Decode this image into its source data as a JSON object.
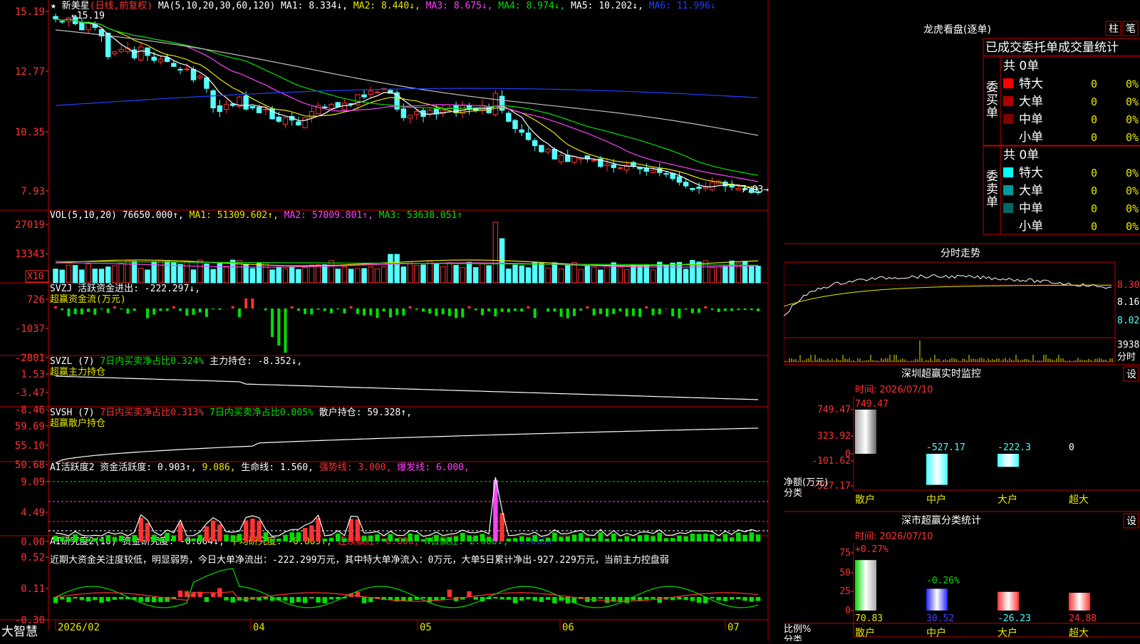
{
  "stock": {
    "name": "新美星",
    "period": "(日线,前复权)",
    "logo": "大智慧",
    "top_price_label": "15.19",
    "low_label": "7.93"
  },
  "colors": {
    "up": "#ff3232",
    "down": "#54ffff",
    "green": "#00e000",
    "ma1": "#ffffff",
    "ma2": "#e8e800",
    "ma3": "#ff40ff",
    "ma4": "#00e000",
    "ma5": "#c0c0c0",
    "ma6": "#2040ff",
    "border": "#c00000",
    "axis_label": "#ff3232"
  },
  "panes": {
    "kline": {
      "header": [
        {
          "t": "MA(5,10,20,30,60,120)",
          "c": "#ffffff"
        },
        {
          "t": "MA1: 8.334↓,",
          "c": "#ffffff"
        },
        {
          "t": "MA2: 8.440↓,",
          "c": "#e8e800"
        },
        {
          "t": "MA3: 8.675↓,",
          "c": "#ff40ff"
        },
        {
          "t": "MA4: 8.974↓,",
          "c": "#00e000"
        },
        {
          "t": "MA5: 10.202↓,",
          "c": "#ffffff"
        },
        {
          "t": "MA6: 11.996↓",
          "c": "#2040ff"
        }
      ],
      "yticks": [
        "15.19",
        "12.77",
        "10.35",
        "7.93"
      ]
    },
    "vol": {
      "header": [
        {
          "t": "VOL(5,10,20)",
          "c": "#ffffff"
        },
        {
          "t": "76650.000↑,",
          "c": "#ffffff"
        },
        {
          "t": "MA1: 51309.602↑,",
          "c": "#e8e800"
        },
        {
          "t": "MA2: 57009.801↑,",
          "c": "#ff40ff"
        },
        {
          "t": "MA3: 53638.051↑",
          "c": "#00e000"
        }
      ],
      "yticks": [
        "27019",
        "13343"
      ],
      "unit": "X10"
    },
    "svzj": {
      "header": [
        {
          "t": "SVZJ",
          "c": "#ffffff"
        },
        {
          "t": "活跃资金进出: -222.297↓,",
          "c": "#ffffff"
        }
      ],
      "sub": "超赢资金流(万元)",
      "yticks": [
        "726",
        "-1037",
        "-2801"
      ]
    },
    "svzl": {
      "header": [
        {
          "t": "SVZL (7)",
          "c": "#ffffff"
        },
        {
          "t": "7日内买卖净占比0.324%",
          "c": "#00e000"
        },
        {
          "t": "主力持仓: -8.352↓,",
          "c": "#ffffff"
        }
      ],
      "sub": "超赢主力持仓",
      "yticks": [
        "1.53",
        "-3.47",
        "-8.46"
      ]
    },
    "svsh": {
      "header": [
        {
          "t": "SVSH (7)",
          "c": "#ffffff"
        },
        {
          "t": "7日内买卖净占比0.313%",
          "c": "#ff3232"
        },
        {
          "t": "7日内买卖净占比0.005%",
          "c": "#00e000"
        },
        {
          "t": "散户持仓: 59.328↑,",
          "c": "#ffffff"
        }
      ],
      "sub": "超赢散户持仓",
      "yticks": [
        "59.69",
        "55.10",
        "50.68"
      ]
    },
    "ai1": {
      "header": [
        {
          "t": "AI活跃度2",
          "c": "#ffffff"
        },
        {
          "t": "资金活跃度: 0.903↑,",
          "c": "#ffffff"
        },
        {
          "t": "9.086,",
          "c": "#e8e800"
        },
        {
          "t": "生命线: 1.560,",
          "c": "#ffffff"
        },
        {
          "t": "强势线: 3.000,",
          "c": "#ff3232"
        },
        {
          "t": "爆发线: 6.000,",
          "c": "#ff40ff"
        }
      ],
      "yticks": [
        "9.09",
        "4.49",
        "0.00"
      ]
    },
    "ai2": {
      "header": [
        {
          "t": "AI研究度2(10)",
          "c": "#ffffff"
        },
        {
          "t": "资金研究度: -0.004↓,",
          "c": "#ffffff"
        },
        {
          "t": "平均研究度: -0.069↑,",
          "c": "#e8e800"
        },
        {
          "t": "连续飘红: 0.000,",
          "c": "#ff3232"
        },
        {
          "t": "N日飘红: 2.000↓,",
          "c": "#00e000"
        },
        {
          "t": "-0.069↑",
          "c": "#2040ff"
        }
      ],
      "comment": "近期大资金关注度较低，明显弱势，今日大单净流出：-222.299万元，其中特大单净流入：0万元，大单5日累计净出-927.229万元，当前主力控盘弱",
      "yticks": [
        "0.52",
        "0.11",
        "-0.30"
      ]
    }
  },
  "dates": [
    "2026/02",
    "04",
    "05",
    "06",
    "07"
  ],
  "chart_data": {
    "type": "candlestick",
    "ylim": [
      7.5,
      15.3
    ],
    "close": [
      15.05,
      14.95,
      15.1,
      14.85,
      14.6,
      14.9,
      14.7,
      14.35,
      13.5,
      13.7,
      13.8,
      13.85,
      13.45,
      13.9,
      13.55,
      13.35,
      13.4,
      13.3,
      13.1,
      12.95,
      13.0,
      12.55,
      12.7,
      12.2,
      11.4,
      11.25,
      11.55,
      11.5,
      11.85,
      11.35,
      11.4,
      11.2,
      11.35,
      10.95,
      10.85,
      11.0,
      10.9,
      10.7,
      11.0,
      11.25,
      11.5,
      11.4,
      11.55,
      11.45,
      11.6,
      11.55,
      11.95,
      11.85,
      12.1,
      12.05,
      12.2,
      12.0,
      11.35,
      11.0,
      11.1,
      11.25,
      11.05,
      11.3,
      11.15,
      11.3,
      11.4,
      11.2,
      11.5,
      11.35,
      11.3,
      11.5,
      11.2,
      12.0,
      11.3,
      10.85,
      10.55,
      10.4,
      10.1,
      9.85,
      9.6,
      9.7,
      9.3,
      9.45,
      9.2,
      9.4,
      9.35,
      9.3,
      9.25,
      9.0,
      9.1,
      8.95,
      8.95,
      9.05,
      9.0,
      8.9,
      8.8,
      8.85,
      8.75,
      8.7,
      8.5,
      8.35,
      8.2,
      8.05,
      8.1,
      8.15,
      8.35,
      8.4,
      8.2,
      8.15,
      8.1,
      8.05,
      7.93,
      7.95
    ]
  },
  "side": {
    "longhu": {
      "title": "龙虎看盘(逐单)",
      "btn1": "柱",
      "btn2": "笔"
    },
    "tabs": {
      "t1": "已成交",
      "t2": "委托单",
      "t3": "成交量统计"
    },
    "buy": {
      "group": "委买单",
      "total": "共 0单",
      "rows": [
        {
          "label": "特大",
          "count": "0",
          "pct": "0%",
          "color": "#ff0000"
        },
        {
          "label": "大单",
          "count": "0",
          "pct": "0%",
          "color": "#b00000"
        },
        {
          "label": "中单",
          "count": "0",
          "pct": "0%",
          "color": "#800000"
        },
        {
          "label": "小单",
          "count": "0",
          "pct": "0%",
          "color": "#000000"
        }
      ]
    },
    "sell": {
      "group": "委卖单",
      "total": "共 0单",
      "rows": [
        {
          "label": "特大",
          "count": "0",
          "pct": "0%",
          "color": "#00ffff"
        },
        {
          "label": "大单",
          "count": "0",
          "pct": "0%",
          "color": "#009999"
        },
        {
          "label": "中单",
          "count": "0",
          "pct": "0%",
          "color": "#006666"
        },
        {
          "label": "小单",
          "count": "0",
          "pct": "0%",
          "color": "#000000"
        }
      ]
    },
    "intraday": {
      "title": "分时走势",
      "prices": [
        "8.30",
        "8.16",
        "8.02"
      ],
      "vol_label": "3938",
      "vol_unit": "分时"
    },
    "sz_monitor": {
      "title": "深圳超赢实时监控",
      "set": "设",
      "time": "时间: 2026/07/10",
      "yticks": [
        "749.47",
        "323.92",
        "0",
        "-101.62",
        "-527.17"
      ],
      "ylabel": "净额(万元)",
      "xlabel": "分类",
      "cats": [
        "散户",
        "中户",
        "大户",
        "超大"
      ],
      "values": [
        749.47,
        -527.17,
        -222.3,
        0
      ],
      "labels": [
        "749.47",
        "-527.17",
        "-222.3",
        "0"
      ]
    },
    "sz_class": {
      "title": "深市超赢分类统计",
      "set": "设",
      "time": "时间: 2026/07/10",
      "yticks": [
        "75",
        "50",
        "25",
        "0"
      ],
      "ylabel": "比例%",
      "xlabel": "分类",
      "cats": [
        "散户",
        "中户",
        "大户",
        "超大"
      ],
      "values": [
        70.83,
        30.52,
        -26.23,
        24.88
      ],
      "top_labels": [
        "+0.27%",
        "-0.26%"
      ],
      "bottom_labels": [
        "70.83",
        "30.52",
        "-26.23",
        "24.88"
      ]
    }
  }
}
